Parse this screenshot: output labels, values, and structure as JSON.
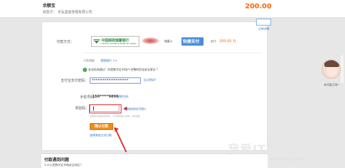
{
  "header": {
    "title": "余额宝",
    "payee": "收款方：    天弘基金管理有限公司",
    "amount": "200.00",
    "unit": "元"
  },
  "order_tab": {
    "label": "订单详情"
  },
  "payment": {
    "method_label": "付款方式：",
    "bank_name": "中国邮政储蓄银行",
    "bank_sub": "POSTAL SAVINGS BANK OF CHINA",
    "card_type": "储蓄卡",
    "quick_badge": "快捷支付",
    "pay_label": "支付",
    "pay_amount": "200.00 元"
  },
  "pay_type": {
    "text": "付款限额",
    "link": "更换银行 >>"
  },
  "security": {
    "text": "安全检测通过！你是数字证书用户,完整的验证安全保证 ?"
  },
  "password": {
    "label": "支付宝支付密码：",
    "value": "••••••••••••••••••••",
    "forgot": "忘记密码?"
  },
  "phone": {
    "label": "手机号码：",
    "number": "150*****9896",
    "change": "更换号码"
  },
  "code": {
    "label": "校验码：",
    "resend": "获取校验码(59秒)",
    "hint": "校验码已发送至您手机，30分钟内输入有效，请勿泄露"
  },
  "confirm_button": "确认付款",
  "other_link": "选择其他方式付款",
  "faq": {
    "title": "付款遇到问题",
    "q1": "1.什么是数字证书和安全保证？"
  },
  "help": {
    "label": "有问题点我~"
  },
  "watermark": {
    "text": "我爱IT技术网",
    "url": "www.52ij.com"
  },
  "colors": {
    "accent": "#f60",
    "link": "#2a72c8",
    "button": "#f08c1a",
    "error": "#e03030",
    "bank": "#2c8a3c",
    "quick": "#4a8ed8"
  }
}
